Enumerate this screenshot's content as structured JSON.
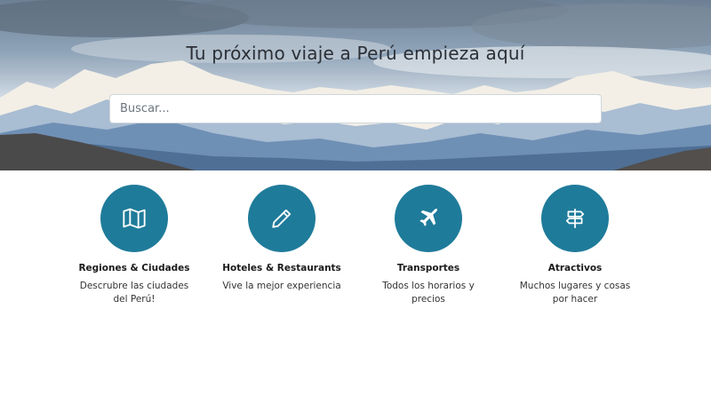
{
  "hero": {
    "title": "Tu próximo viaje a Perú empieza aquí",
    "background_description_colors": {
      "sky": "#8ea3b8",
      "snow": "#f3efe6",
      "mountain": "#5f7fa6",
      "ground": "#4a4a4a"
    }
  },
  "search": {
    "placeholder": "Buscar..."
  },
  "theme": {
    "accent": "#1f7b9a"
  },
  "features": [
    {
      "icon": "map-icon",
      "title": "Regiones & Ciudades",
      "description": "Descrubre las ciudades del Perú!"
    },
    {
      "icon": "pencil-icon",
      "title": "Hoteles & Restaurants",
      "description": "Vive la mejor experiencia"
    },
    {
      "icon": "plane-icon",
      "title": "Transportes",
      "description": "Todos los horarios y precios"
    },
    {
      "icon": "signpost-icon",
      "title": "Atractivos",
      "description": "Muchos lugares y cosas por hacer"
    }
  ]
}
